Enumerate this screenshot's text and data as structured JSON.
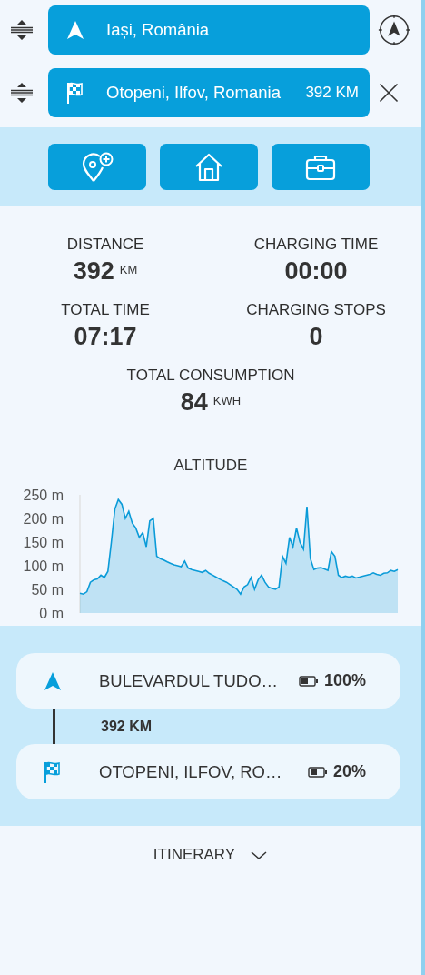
{
  "route": [
    {
      "kind": "start",
      "value": "Iași, România",
      "action": {
        "kind": "locate"
      }
    },
    {
      "kind": "destination",
      "value": "Otopeni, Ilfov, Romania",
      "distance": "392 KM",
      "action": {
        "kind": "remove"
      }
    }
  ],
  "quick_buttons": [
    {
      "kind": "add-stop"
    },
    {
      "kind": "home"
    },
    {
      "kind": "work"
    }
  ],
  "stats": [
    {
      "label": "DISTANCE",
      "value": "392",
      "unit": "KM"
    },
    {
      "label": "CHARGING TIME",
      "value": "00:00"
    },
    {
      "label": "TOTAL TIME",
      "value": "07:17"
    },
    {
      "label": "CHARGING STOPS",
      "value": "0"
    },
    {
      "label": "TOTAL CONSUMPTION",
      "value": "84",
      "unit": "KWH"
    }
  ],
  "altitude": {
    "title": "ALTITUDE",
    "chart_data": {
      "type": "area",
      "ylim": [
        0,
        250
      ],
      "yticks": [
        {
          "value": 0,
          "label": "0 m"
        },
        {
          "value": 50,
          "label": "50 m"
        },
        {
          "value": 100,
          "label": "100 m"
        },
        {
          "value": 150,
          "label": "150 m"
        },
        {
          "value": 200,
          "label": "200 m"
        },
        {
          "value": 250,
          "label": "250 m"
        }
      ],
      "series": [
        {
          "color": "#0a9bd8",
          "values": [
            42,
            40,
            45,
            65,
            70,
            72,
            80,
            75,
            88,
            150,
            220,
            240,
            230,
            200,
            215,
            190,
            180,
            160,
            170,
            140,
            195,
            200,
            120,
            115,
            112,
            108,
            105,
            102,
            100,
            98,
            110,
            95,
            92,
            90,
            88,
            86,
            90,
            84,
            80,
            76,
            72,
            68,
            65,
            60,
            55,
            50,
            40,
            55,
            60,
            75,
            50,
            70,
            80,
            65,
            55,
            52,
            50,
            55,
            120,
            105,
            160,
            140,
            180,
            150,
            135,
            225,
            115,
            92,
            95,
            96,
            93,
            90,
            130,
            120,
            80,
            75,
            78,
            76,
            78,
            74,
            76,
            78,
            80,
            82,
            85,
            82,
            80,
            84,
            85,
            90,
            88,
            92
          ]
        }
      ]
    }
  },
  "stops": [
    {
      "kind": "start",
      "name": "BULEVARDUL TUDO…",
      "battery": "100%"
    },
    {
      "kind": "destination",
      "name": "OTOPENI, ILFOV, RO…",
      "battery": "20%"
    }
  ],
  "leg_distance": "392 KM",
  "itinerary": {
    "label": "ITINERARY",
    "expanded": false
  }
}
